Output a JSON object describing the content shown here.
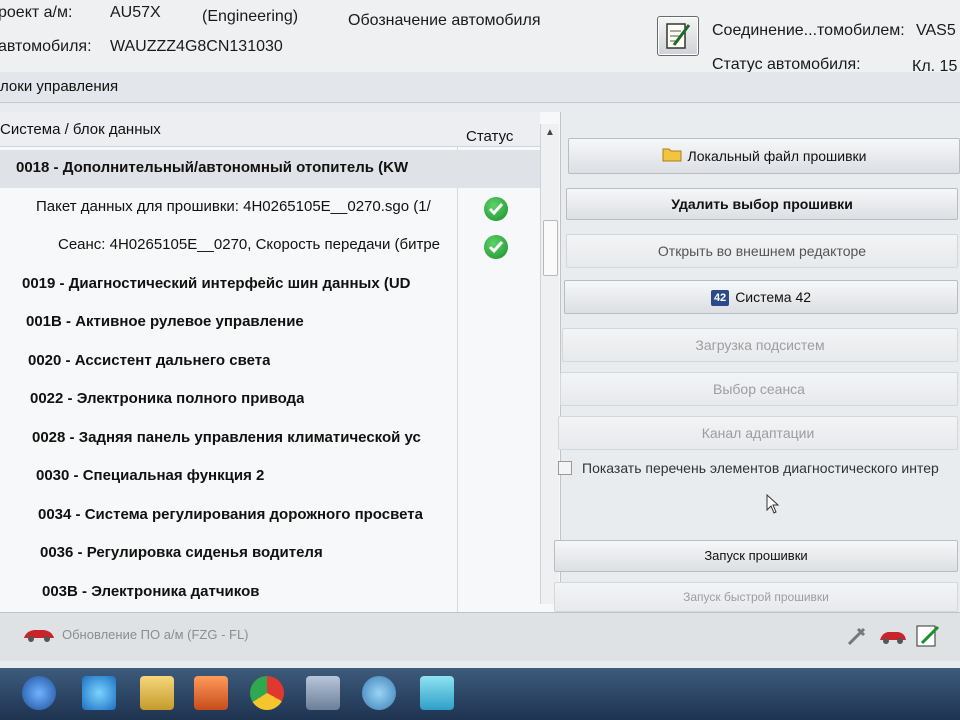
{
  "header": {
    "project_label": "роект а/м:",
    "project_value": "AU57X",
    "project_mode": "(Engineering)",
    "vehicle_designation_label": "Обозначение автомобиля",
    "vin_label": "автомобиля:",
    "vin_value": "WAUZZZ4G8CN131030",
    "connection_label": "Соединение...томобилем:",
    "connection_value": "VAS5",
    "vehicle_status_label": "Статус автомобиля:",
    "vehicle_status_value": "Кл. 15",
    "edit_icon": "edit-note-icon"
  },
  "section": {
    "title": "локи управления"
  },
  "list": {
    "columns": {
      "system": "Система / блок данных",
      "status": "Статус"
    },
    "rows": [
      {
        "text": "0018 - Дополнительный/автономный отопитель  (KW",
        "bold": true,
        "selected": true,
        "indent": 16,
        "status": ""
      },
      {
        "text": "Пакет данных для прошивки: 4H0265105E__0270.sgo (1/",
        "bold": false,
        "selected": false,
        "indent": 36,
        "status": "ok"
      },
      {
        "text": "Сеанс: 4H0265105E__0270, Скорость передачи (битре",
        "bold": false,
        "selected": false,
        "indent": 58,
        "status": "ok"
      },
      {
        "text": "0019 - Диагностический интерфейс шин данных  (UD",
        "bold": true,
        "selected": false,
        "indent": 22,
        "status": ""
      },
      {
        "text": "001B - Активное рулевое управление",
        "bold": true,
        "selected": false,
        "indent": 26,
        "status": ""
      },
      {
        "text": "0020 - Ассистент дальнего света",
        "bold": true,
        "selected": false,
        "indent": 28,
        "status": ""
      },
      {
        "text": "0022 - Электроника полного привода",
        "bold": true,
        "selected": false,
        "indent": 30,
        "status": ""
      },
      {
        "text": "0028 - Задняя панель управления климатической ус",
        "bold": true,
        "selected": false,
        "indent": 32,
        "status": ""
      },
      {
        "text": "0030 - Специальная функция 2",
        "bold": true,
        "selected": false,
        "indent": 36,
        "status": ""
      },
      {
        "text": "0034 - Система регулирования дорожного просвета",
        "bold": true,
        "selected": false,
        "indent": 38,
        "status": ""
      },
      {
        "text": "0036 - Регулировка сиденья водителя",
        "bold": true,
        "selected": false,
        "indent": 40,
        "status": ""
      },
      {
        "text": "003B - Электроника датчиков",
        "bold": true,
        "selected": false,
        "indent": 42,
        "status": ""
      }
    ]
  },
  "buttons": {
    "local_file": "Локальный файл прошивки",
    "delete_selection": "Удалить выбор прошивки",
    "open_external": "Открыть во внешнем редакторе",
    "system42": "Система 42",
    "system42_badge": "42",
    "load_subsystems": "Загрузка подсистем",
    "select_session": "Выбор сеанса",
    "adaptation_channel": "Канал адаптации",
    "start_flash": "Запуск прошивки",
    "quick_flash": "Запуск быстрой прошивки"
  },
  "checkbox": {
    "label": "Показать перечень элементов диагностического интер",
    "checked": false
  },
  "statusbar": {
    "text": "Обновление ПО а/м (FZG - FL)"
  },
  "colors": {
    "accent_green": "#1a8f2b",
    "taskbar": "#2b4566"
  }
}
